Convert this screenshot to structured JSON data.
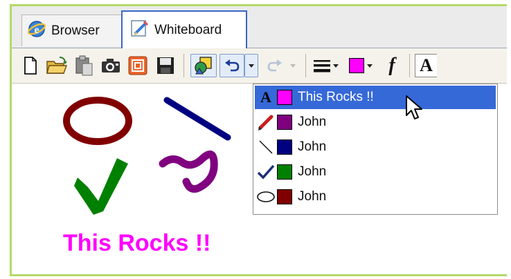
{
  "tabs": [
    {
      "label": "Browser",
      "icon": "ie-globe-icon"
    },
    {
      "label": "Whiteboard",
      "icon": "whiteboard-pencil-icon",
      "active": true
    }
  ],
  "toolbar": {
    "buttons": [
      "new-document-icon",
      "open-folder-icon",
      "paste-icon",
      "camera-icon",
      "presentation-icon",
      "save-icon",
      "shapes-icon",
      "undo-icon",
      "redo-icon",
      "line-width-icon",
      "color-icon",
      "font-italic-f-icon",
      "text-a-icon"
    ],
    "current_color": "#ff00ff",
    "text_tool_glyph": "A",
    "font_glyph": "f"
  },
  "history_dropdown": {
    "items": [
      {
        "icon": "text-a-icon",
        "color": "#ff00ff",
        "label": "This Rocks !!",
        "selected": true
      },
      {
        "icon": "pencil-icon",
        "color": "#800080",
        "label": "John"
      },
      {
        "icon": "line-icon",
        "color": "#000080",
        "label": "John"
      },
      {
        "icon": "check-icon",
        "color": "#008000",
        "label": "John"
      },
      {
        "icon": "ellipse-icon",
        "color": "#800000",
        "label": "John"
      }
    ],
    "first_item_glyph": "A"
  },
  "canvas": {
    "text": "This Rocks !!",
    "text_color": "#ff00ff",
    "shapes": [
      {
        "type": "ellipse",
        "color": "#800000"
      },
      {
        "type": "line",
        "color": "#000080"
      },
      {
        "type": "checkmark",
        "color": "#008000"
      },
      {
        "type": "freehand",
        "color": "#800080"
      }
    ]
  },
  "colors": {
    "frame_border": "#b4d96a",
    "active_tab_border": "#3b67c8",
    "selection": "#3669d8"
  }
}
